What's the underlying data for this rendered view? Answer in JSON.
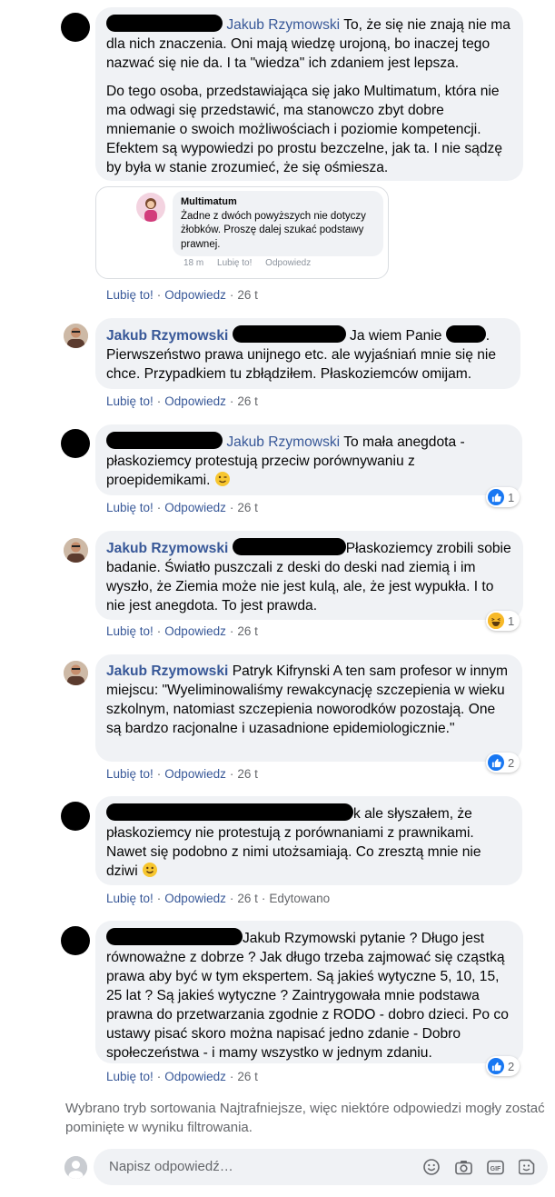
{
  "actions": {
    "like": "Lubię to!",
    "reply": "Odpowiedz",
    "time": "26 t",
    "edited": "Edytowano"
  },
  "comments": [
    {
      "mention": "Jakub Rzymowski",
      "paragraph1": "To, że się nie znają nie ma dla nich znaczenia. Oni mają wiedzę urojoną, bo inaczej tego nazwać się nie da. I ta \"wiedza\" ich zdaniem jest lepsza.",
      "paragraph2": "Do tego osoba, przedstawiająca się jako Multimatum, która nie ma odwagi się przedstawić, ma stanowczo zbyt dobre mniemanie o swoich możliwościach i poziomie kompetencji. Efektem są wypowiedzi po prostu bezczelne, jak ta. I nie sądzę by była w stanie zrozumieć, że się ośmiesza.",
      "attachment": {
        "name": "Multimatum",
        "text": "Żadne z dwóch powyższych nie dotyczy żłobków. Proszę dalej szukać podstawy prawnej.",
        "time": "18 m",
        "like": "Lubię to!",
        "reply": "Odpowiedz"
      }
    },
    {
      "author": "Jakub Rzymowski",
      "text_a": "Ja wiem Panie",
      "text_b": ". Pierwszeństwo prawa unijnego etc. ale wyjaśniań mnie się nie chce. Przypadkiem tu zbłądziłem. Płaskoziemców omijam."
    },
    {
      "mention": "Jakub Rzymowski",
      "text": "To mała anegdota - płaskoziemcy protestują przeciw porównywaniu z proepidemikami.",
      "reaction_icon": "like-icon",
      "reaction_count": "1"
    },
    {
      "author": "Jakub Rzymowski",
      "text": "Płaskoziemcy zrobili sobie badanie. Światło puszczali z deski do deski nad ziemią i im wyszło, że Ziemia może nie jest kulą, ale, że jest wypukła. I to nie jest anegdota. To jest prawda.",
      "reaction_icon": "haha-icon",
      "reaction_count": "1"
    },
    {
      "author": "Jakub Rzymowski",
      "text": "Patryk Kifrynski A ten sam profesor w innym miejscu: \"Wyeliminowaliśmy rewakcynację szczepienia w wieku szkolnym, natomiast szczepienia noworodków pozostają. One są bardzo racjonalne i uzasadnione epidemiologicznie.\"",
      "reaction_icon": "like-icon",
      "reaction_count": "2"
    },
    {
      "text_a": "k ale słyszałem, że płaskoziemcy nie protestują z porównaniami z prawnikami. Nawet się podobno z nimi utożsamiają. Co zresztą mnie nie dziwi"
    },
    {
      "text": "Jakub Rzymowski pytanie ? Długo jest równoważne z dobrze ? Jak długo trzeba zajmować się cząstką prawa aby być w tym ekspertem. Są jakieś wytyczne 5, 10, 15, 25 lat ? Są jakieś wytyczne ? Zaintrygowała mnie podstawa prawna do przetwarzania zgodnie z RODO - dobro dzieci. Po co ustawy pisać skoro można napisać jedno zdanie - Dobro społeczeństwa - i mamy wszystko w jednym zdaniu.",
      "reaction_icon": "like-icon",
      "reaction_count": "2"
    }
  ],
  "sort_note": "Wybrano tryb sortowania Najtrafniejsze, więc niektóre odpowiedzi mogły zostać pominięte w wyniku filtrowania.",
  "composer": {
    "placeholder": "Napisz odpowiedź…",
    "icons": [
      "emoji-icon",
      "camera-icon",
      "gif-icon",
      "sticker-icon"
    ]
  },
  "colors": {
    "link": "#385898",
    "bubble": "#f0f2f5",
    "muted": "#65676b",
    "like_blue": "#1877f2"
  }
}
